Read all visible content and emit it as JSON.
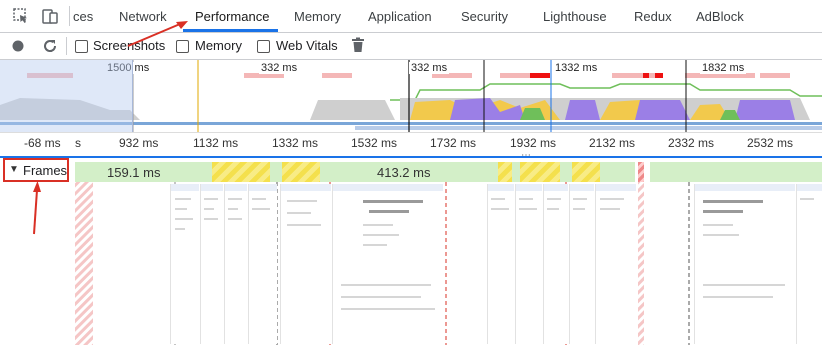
{
  "tabs": {
    "items": [
      "ces",
      "Network",
      "Performance",
      "Memory",
      "Application",
      "Security",
      "Lighthouse",
      "Redux",
      "AdBlock"
    ],
    "active": "Performance"
  },
  "toolbar": {
    "screenshots_label": "Screenshots",
    "memory_label": "Memory",
    "web_vitals_label": "Web Vitals",
    "screenshots_checked": false,
    "memory_checked": false,
    "web_vitals_checked": false
  },
  "overview": {
    "labels": [
      "1500 ms",
      "332 ms",
      "332 ms",
      "1332 ms",
      "1832 ms"
    ]
  },
  "ruler": {
    "labels": [
      "-68 ms",
      "s",
      "932 ms",
      "1132 ms",
      "1332 ms",
      "1532 ms",
      "1732 ms",
      "1932 ms",
      "2132 ms",
      "2332 ms",
      "2532 ms"
    ]
  },
  "frames": {
    "label": "Frames",
    "segments": [
      "159.1 ms",
      "413.2 ms"
    ]
  },
  "colors": {
    "accent": "#1a73e8",
    "annotation": "#d93025",
    "frame_green": "#d3efc8",
    "scripting": "#f2c94c",
    "rendering": "#9b7fe6",
    "painting": "#6fbf5a",
    "system": "#c9c9c9"
  },
  "icons": [
    "inspect-icon",
    "device-toggle-icon",
    "record-icon",
    "reload-icon",
    "trash-icon",
    "expand-triangle-icon"
  ]
}
